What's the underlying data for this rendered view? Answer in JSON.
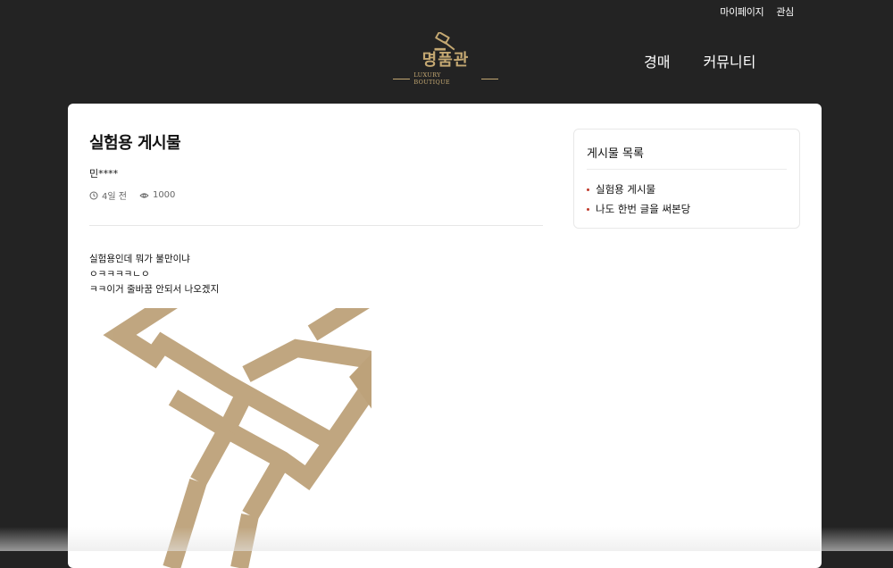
{
  "header": {
    "links": [
      "마이페이지",
      "관심"
    ],
    "logo": {
      "text": "명품관",
      "subtitle": "LUXURY BOUTIQUE"
    },
    "nav": [
      "경매",
      "커뮤니티"
    ],
    "brand_color": "#c4a872"
  },
  "post": {
    "title": "실험용 게시물",
    "author": "민****",
    "time": "4일 전",
    "views": "1000",
    "lines": [
      "실험용인데 뭐가 불만이냐",
      "ㅇㅋㅋㅋㅋㄴㅇ",
      "ㅋㅋ이거 줄바꿈 안되서 나오겠지"
    ]
  },
  "sidebar": {
    "title": "게시물 목록",
    "items": [
      "실험용 게시물",
      "나도 한번 글을 써본당"
    ]
  }
}
